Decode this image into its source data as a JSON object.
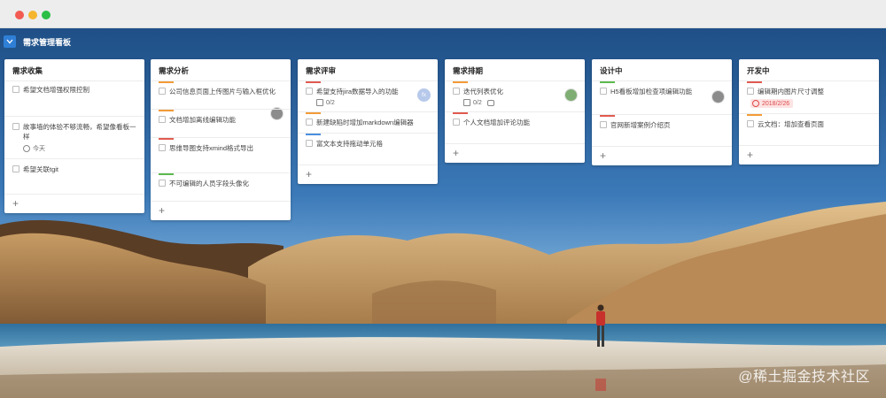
{
  "colors": {
    "accent": "#2f7fd6",
    "bar_orange": "#f29b38",
    "bar_red": "#e15b50",
    "bar_green": "#5db94e",
    "bar_blue": "#4a8fdc",
    "date_red": "#e04848"
  },
  "board": {
    "title": "需求管理看板",
    "toggle_icon": "chevron-down-icon"
  },
  "columns": [
    {
      "title": "需求收集",
      "cards": [
        {
          "text": "希望文档增强权限控制",
          "bar": ""
        },
        {
          "text": "故事墙的体验不够流畅，希望像看板一样",
          "bar": "",
          "meta": "今天"
        },
        {
          "text": "希望关联tgit",
          "bar": ""
        }
      ],
      "add": "+"
    },
    {
      "title": "需求分析",
      "cards": [
        {
          "text": "公司信息页面上传图片与输入框优化",
          "bar": "orange",
          "avatar": "user-avatar"
        },
        {
          "text": "文档增加离线编辑功能",
          "bar": "orange"
        },
        {
          "text": "思维导图支持xmind格式导出",
          "bar": "red"
        },
        {
          "text": "不可编辑的人员字段头像化",
          "bar": "green"
        }
      ],
      "add": "+"
    },
    {
      "title": "需求评审",
      "cards": [
        {
          "text": "希望支持jira数据导入的功能",
          "bar": "red",
          "meta": "0/2",
          "avatar_text": "fx"
        },
        {
          "text": "新建缺陷时增加markdown编辑器",
          "bar": "orange"
        },
        {
          "text": "富文本支持拖动单元格",
          "bar": "blue"
        }
      ],
      "add": "+"
    },
    {
      "title": "需求排期",
      "cards": [
        {
          "text": "迭代列表优化",
          "bar": "orange",
          "meta": "0/2",
          "avatar": "user-avatar"
        },
        {
          "text": "个人文档增加评论功能",
          "bar": "red"
        }
      ],
      "add": "+"
    },
    {
      "title": "设计中",
      "cards": [
        {
          "text": "H5看板增加检查项编辑功能",
          "bar": "green",
          "avatar": "user-avatar"
        },
        {
          "text": "官网新增案例介绍页",
          "bar": "red"
        }
      ],
      "add": "+"
    },
    {
      "title": "开发中",
      "cards": [
        {
          "text": "编辑期内图片尺寸调整",
          "bar": "red",
          "date": "2018/2/26"
        },
        {
          "text": "云文档：增加查看页面",
          "bar": "orange"
        }
      ],
      "add": "+"
    }
  ],
  "watermark": "@稀土掘金技术社区"
}
